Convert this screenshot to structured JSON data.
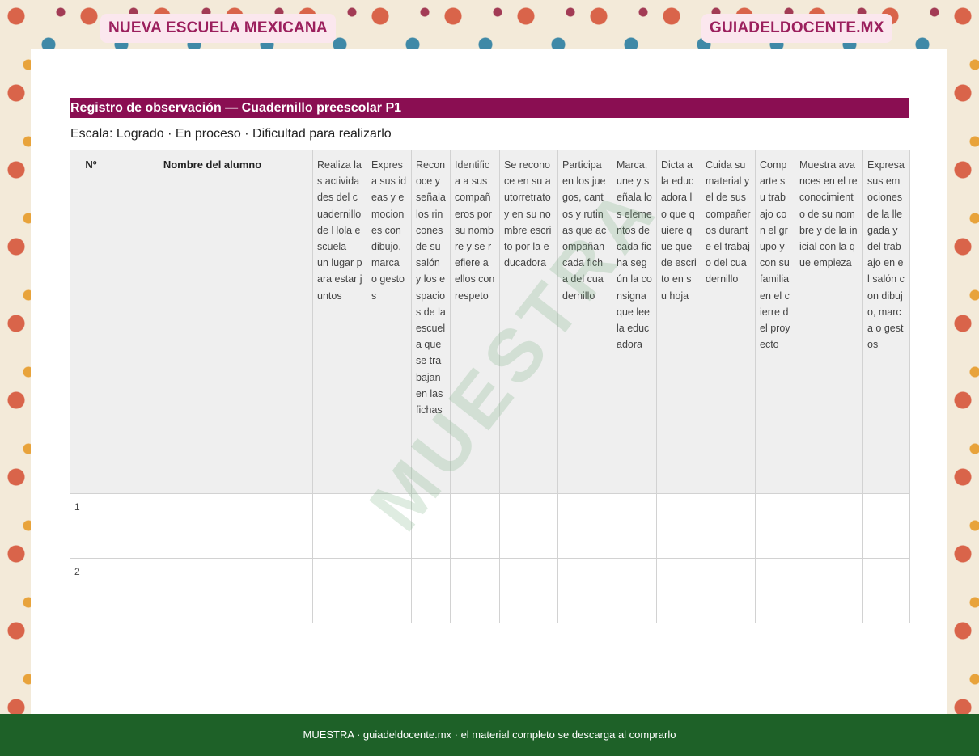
{
  "header": {
    "left_badge": "NUEVA ESCUELA MEXICANA",
    "right_badge": "GUIADELDOCENTE.MX"
  },
  "document": {
    "title": "Registro de observación — Cuadernillo preescolar P1",
    "scale": "Escala: Logrado · En proceso · Dificultad para realizarlo",
    "watermark": "MUESTRA"
  },
  "table": {
    "headers": [
      "Nº",
      "Nombre del alumno",
      "Realiza las actividades del cuadernillo de Hola escuela — un lugar para estar juntos",
      "Expresa sus ideas y emociones con dibujo, marca o gestos",
      "Reconoce y señala los rincones de su salón y los espacios de la escuela que se trabajan en las fichas",
      "Identifica a sus compañeros por su nombre y se refiere a ellos con respeto",
      "Se reconoce en su autorretrato y en su nombre escrito por la educadora",
      "Participa en los juegos, cantos y rutinas que acompañan cada ficha del cuadernillo",
      "Marca, une y señala los elementos de cada ficha según la consigna que lee la educadora",
      "Dicta a la educadora lo que quiere que quede escrito en su hoja",
      "Cuida su material y el de sus compañeros durante el trabajo del cuadernillo",
      "Comparte su trabajo con el grupo y con su familia en el cierre del proyecto",
      "Muestra avances en el reconocimiento de su nombre y de la inicial con la que empieza",
      "Expresa sus emociones de la llegada y del trabajo en el salón con dibujo, marca o gestos"
    ],
    "rows": [
      {
        "num": "1"
      },
      {
        "num": "2"
      }
    ]
  },
  "footer": {
    "text": "MUESTRA · guiadeldocente.mx · el material completo se descarga al comprarlo"
  }
}
